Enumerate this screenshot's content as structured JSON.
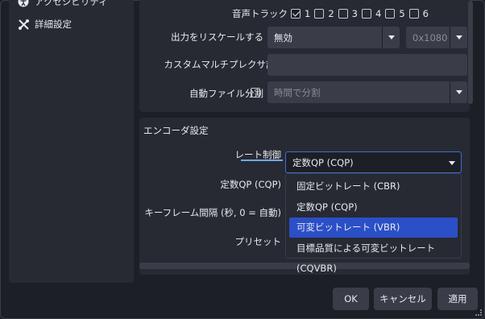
{
  "sidebar": {
    "items": [
      {
        "label": "アクセシビリティ",
        "icon": "accessibility-icon"
      },
      {
        "label": "詳細設定",
        "icon": "tools-icon"
      }
    ]
  },
  "output": {
    "audio_track_label": "音声トラック",
    "tracks": [
      "1",
      "2",
      "3",
      "4",
      "5",
      "6"
    ],
    "rescale_label": "出力をリスケールする",
    "rescale_value": "無効",
    "rescale_resolution": "0x1080",
    "muxer_label": "カスタムマルチプレクサ設定",
    "autosplit_label": "自動ファイル分割",
    "autosplit_value": "時間で分割"
  },
  "encoder": {
    "section_title": "エンコーダ設定",
    "rate_control_label": "レート制御",
    "rate_control_value": "定数QP (CQP)",
    "cqp_label": "定数QP (CQP)",
    "keyframe_label": "キーフレーム間隔 (秒, 0 = 自動)",
    "preset_label": "プリセット",
    "options": [
      "固定ビットレート (CBR)",
      "定数QP (CQP)",
      "可変ビットレート (VBR)",
      "目標品質による可変ビットレート (CQVBR)"
    ]
  },
  "footer": {
    "ok": "OK",
    "cancel": "キャンセル",
    "apply": "適用"
  },
  "colors": {
    "accent": "#2b4fc7",
    "bg": "#1d1f26",
    "panel": "#272a33",
    "control": "#3a3d47"
  }
}
